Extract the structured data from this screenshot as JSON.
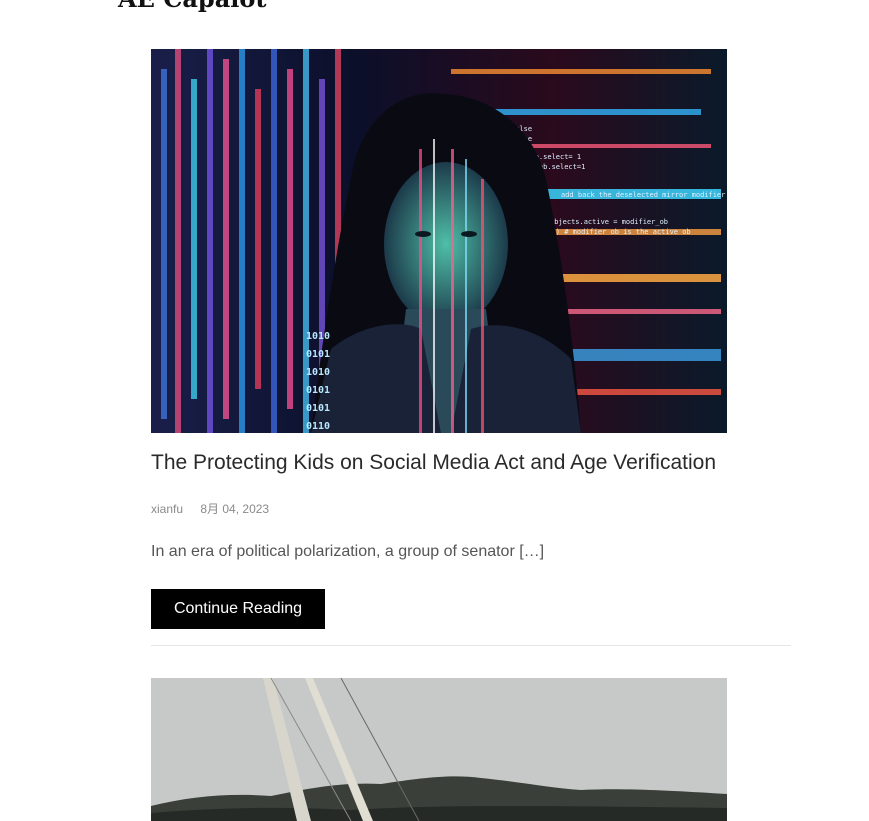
{
  "site": {
    "title": "AE Capalot"
  },
  "posts": [
    {
      "title": "The Protecting Kids on Social Media Act and Age Verification",
      "author": "xianfu",
      "date": "8月 04, 2023",
      "excerpt": "In an era of political polarization, a group of senator […]",
      "read_more_label": "Continue Reading",
      "image": {
        "icon": "woman-code-projection-image",
        "code_lines": [
          "add back the deselected mirror modifier",
          "mirror_ob.select= 1",
          "modifier_ob.select=1",
          "context.scene.objects.active = modifier_ob",
          "(modifier_ob)) # modifier ob is the active ob",
          "false",
          "false",
          "true"
        ],
        "binary_lines": [
          "1010",
          "0101",
          "1010",
          "0101",
          "0101",
          "0110"
        ]
      }
    },
    {
      "image": {
        "icon": "sailboat-mast-image"
      }
    }
  ],
  "colors": {
    "button_bg": "#000000",
    "button_text": "#ffffff",
    "title_text": "#2a2a2a",
    "meta_text": "#8a8a8a",
    "divider": "#e6e6e6"
  }
}
